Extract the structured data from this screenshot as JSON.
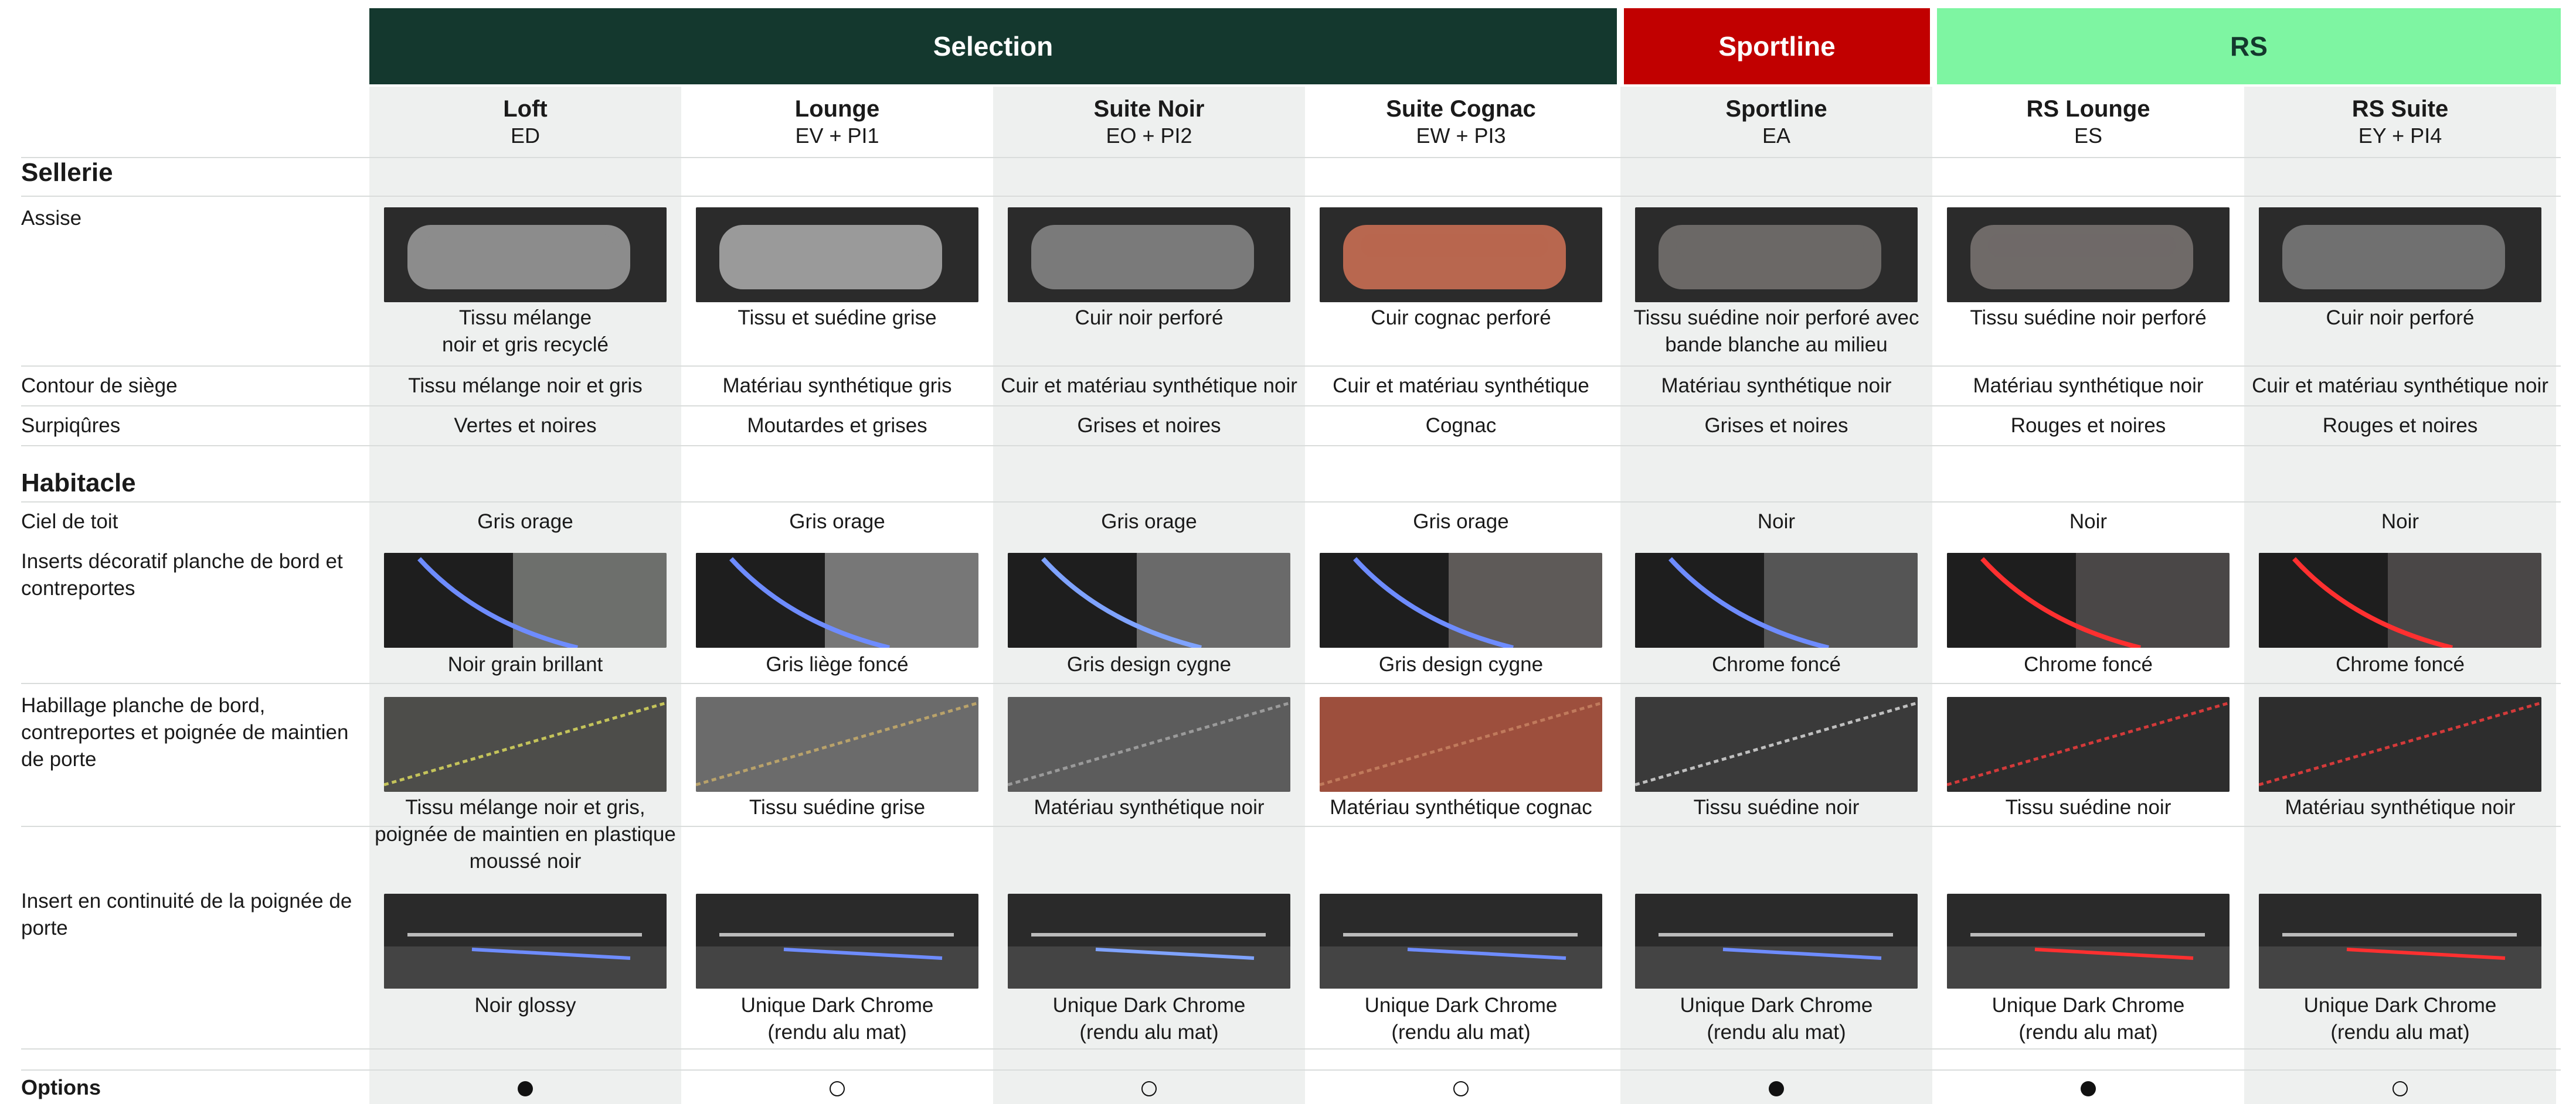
{
  "groups": {
    "selection": "Selection",
    "sportline": "Sportline",
    "rs": "RS"
  },
  "colors": {
    "selection": "#14382e",
    "sportline": "#c10000",
    "rs": "#7ef5a2"
  },
  "columns": [
    {
      "title": "Loft",
      "code": "ED"
    },
    {
      "title": "Lounge",
      "code": "EV + PI1"
    },
    {
      "title": "Suite Noir",
      "code": "EO + PI2"
    },
    {
      "title": "Suite Cognac",
      "code": "EW + PI3"
    },
    {
      "title": "Sportline",
      "code": "EA"
    },
    {
      "title": "RS Lounge",
      "code": "ES"
    },
    {
      "title": "RS Suite",
      "code": "EY + PI4"
    }
  ],
  "sections": {
    "sellerie": "Sellerie",
    "habitacle": "Habitacle",
    "options": "Options"
  },
  "rows": {
    "assise": {
      "label": "Assise",
      "values": [
        "Tissu mélange\nnoir et gris recyclé",
        "Tissu et suédine grise",
        "Cuir noir perforé",
        "Cuir cognac perforé",
        "Tissu suédine noir perforé avec\nbande blanche au milieu",
        "Tissu suédine noir perforé",
        "Cuir noir perforé"
      ]
    },
    "contour": {
      "label": "Contour de siège",
      "values": [
        "Tissu mélange noir et gris",
        "Matériau synthétique gris",
        "Cuir et matériau synthétique noir",
        "Cuir et matériau synthétique",
        "Matériau synthétique noir",
        "Matériau synthétique noir",
        "Cuir et matériau synthétique noir"
      ]
    },
    "surpiqures": {
      "label": "Surpiqûres",
      "values": [
        "Vertes et noires",
        "Moutardes et grises",
        "Grises et noires",
        "Cognac",
        "Grises et noires",
        "Rouges et noires",
        "Rouges et noires"
      ]
    },
    "ciel": {
      "label": "Ciel de toit",
      "values": [
        "Gris orage",
        "Gris orage",
        "Gris orage",
        "Gris orage",
        "Noir",
        "Noir",
        "Noir"
      ]
    },
    "inserts": {
      "label": "Inserts décoratif planche de bord et\ncontreportes",
      "values": [
        "Noir grain brillant",
        "Gris liège foncé",
        "Gris design cygne",
        "Gris design cygne",
        "Chrome foncé",
        "Chrome foncé",
        "Chrome foncé"
      ]
    },
    "habillage": {
      "label": "Habillage planche de bord,\ncontreportes et poignée de maintien\nde porte",
      "values": [
        "Tissu mélange noir et gris,\npoignée de maintien en plastique\nmoussé noir",
        "Tissu suédine grise",
        "Matériau synthétique noir",
        "Matériau synthétique cognac",
        "Tissu suédine noir",
        "Tissu suédine noir",
        "Matériau synthétique noir"
      ]
    },
    "continuite": {
      "label": "Insert en continuité de la poignée de\nporte",
      "values": [
        "Noir glossy",
        "Unique Dark Chrome\n(rendu alu mat)",
        "Unique Dark Chrome\n(rendu alu mat)",
        "Unique Dark Chrome\n(rendu alu mat)",
        "Unique Dark Chrome\n(rendu alu mat)",
        "Unique Dark Chrome\n(rendu alu mat)",
        "Unique Dark Chrome\n(rendu alu mat)"
      ]
    },
    "options": {
      "values": [
        "filled",
        "empty",
        "empty",
        "empty",
        "filled",
        "filled",
        "empty"
      ]
    }
  }
}
